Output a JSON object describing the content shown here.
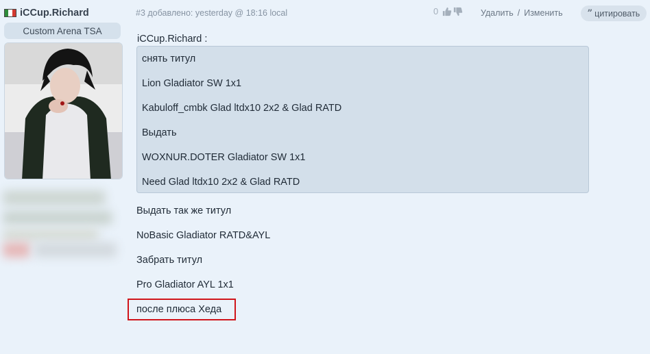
{
  "user": {
    "name": "iCCup.Richard",
    "group": "Custom Arena TSA",
    "flag_colors": [
      "#2e8b3a",
      "#ffffff",
      "#d33a32"
    ]
  },
  "post": {
    "number": "#3",
    "meta_text": "добавлено: yesterday @ 18:16 local",
    "vote_count": "0",
    "delete_label": "Удалить",
    "separator": "/",
    "edit_label": "Изменить",
    "quote_button_label": "цитировать",
    "quote_author": "iCCup.Richard :",
    "quote_lines": [
      "снять титул",
      "Lion Gladiator SW 1x1",
      "Kabuloff_cmbk Glad ltdx10 2x2 & Glad RATD",
      "Выдать",
      "WOXNUR.DOTER Gladiator SW 1x1",
      "Need Glad ltdx10 2x2 & Glad RATD"
    ],
    "body_lines": [
      "Выдать так же титул",
      "NoBasic Gladiator RATD&AYL",
      "Забрать титул",
      "Pro Gladiator AYL 1x1",
      "после плюса Хеда"
    ]
  },
  "colors": {
    "background": "#eaf2fa",
    "quote_background": "#d3dfea",
    "highlight_border": "#d0141a"
  }
}
